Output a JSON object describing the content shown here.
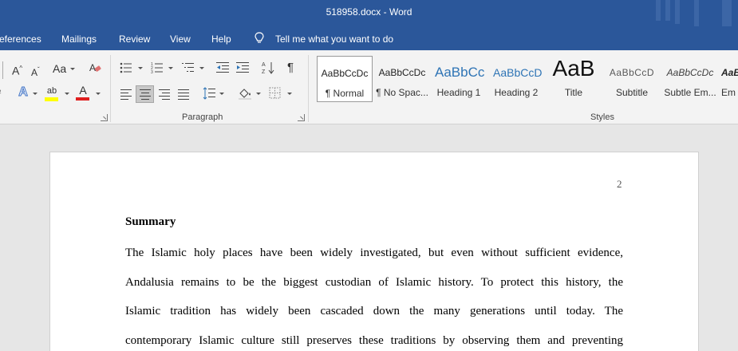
{
  "window": {
    "title": "518958.docx  -  Word"
  },
  "menu": {
    "tabs": [
      "eferences",
      "Mailings",
      "Review",
      "View",
      "Help"
    ],
    "tell_me": "Tell me what you want to do"
  },
  "ribbon": {
    "paragraph_label": "Paragraph",
    "styles_label": "Styles",
    "font_glyphs": {
      "grow": "A",
      "shrink": "A",
      "case": "Aa",
      "highlight": "ab",
      "font_color": "A",
      "text_effects": "A"
    },
    "pilcrow": "¶"
  },
  "styles": [
    {
      "preview": "AaBbCcDc",
      "name": "¶ Normal",
      "color": "#222222"
    },
    {
      "preview": "AaBbCcDc",
      "name": "¶ No Spac...",
      "color": "#222222"
    },
    {
      "preview": "AaBbCc",
      "name": "Heading 1",
      "color": "#2e74b5"
    },
    {
      "preview": "AaBbCcD",
      "name": "Heading 2",
      "color": "#2e74b5"
    },
    {
      "preview": "AaB",
      "name": "Title",
      "color": "#111111"
    },
    {
      "preview": "AaBbCcD",
      "name": "Subtitle",
      "color": "#595959"
    },
    {
      "preview": "AaBbCcDc",
      "name": "Subtle Em...",
      "color": "#404040"
    },
    {
      "preview": "AaB",
      "name": "Em",
      "color": "#222222"
    }
  ],
  "document": {
    "page_number": "2",
    "heading": "Summary",
    "lines": [
      "The Islamic holy places have been widely investigated, but even without sufficient evidence,",
      "Andalusia remains to be the biggest custodian of Islamic history. To protect this history, the",
      "Islamic tradition has widely been cascaded down the many generations until today. The",
      "contemporary Islamic culture still preserves these traditions by observing them and preventing"
    ]
  },
  "colors": {
    "accent": "#2b579a",
    "highlight": "#ffff00",
    "font_red": "#e02020"
  }
}
